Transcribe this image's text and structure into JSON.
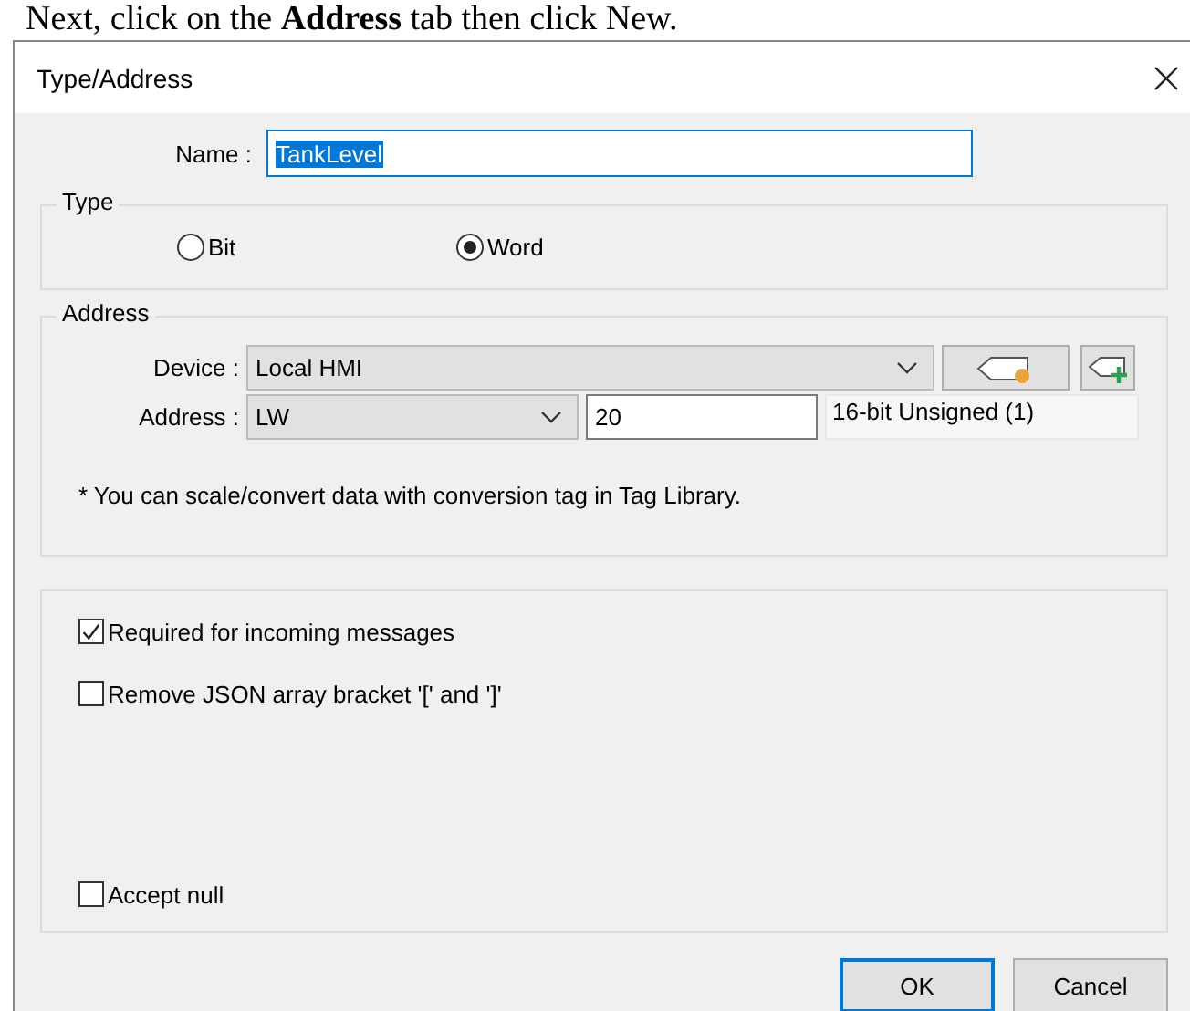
{
  "doc_caption": "Next, click on the **Address** tab then click New.",
  "window": {
    "title": "Type/Address"
  },
  "name_field": {
    "label": "Name :",
    "value": "TankLevel",
    "text_selected": true
  },
  "type_group": {
    "title": "Type",
    "options": [
      {
        "label": "Bit",
        "selected": false
      },
      {
        "label": "Word",
        "selected": true
      }
    ]
  },
  "address_group": {
    "title": "Address",
    "device": {
      "label": "Device :",
      "value": "Local HMI"
    },
    "address": {
      "label": "Address :",
      "type": "LW",
      "value": "20",
      "format": "16-bit Unsigned (1)"
    },
    "note": "* You can scale/convert data with conversion tag in Tag Library."
  },
  "options": [
    {
      "label": "Required for incoming messages",
      "checked": true
    },
    {
      "label": "Remove JSON array bracket '[' and ']'",
      "checked": false
    },
    {
      "label": "Accept null",
      "checked": false
    }
  ],
  "buttons": [
    {
      "label": "OK",
      "default": true
    },
    {
      "label": "Cancel",
      "default": false
    }
  ]
}
